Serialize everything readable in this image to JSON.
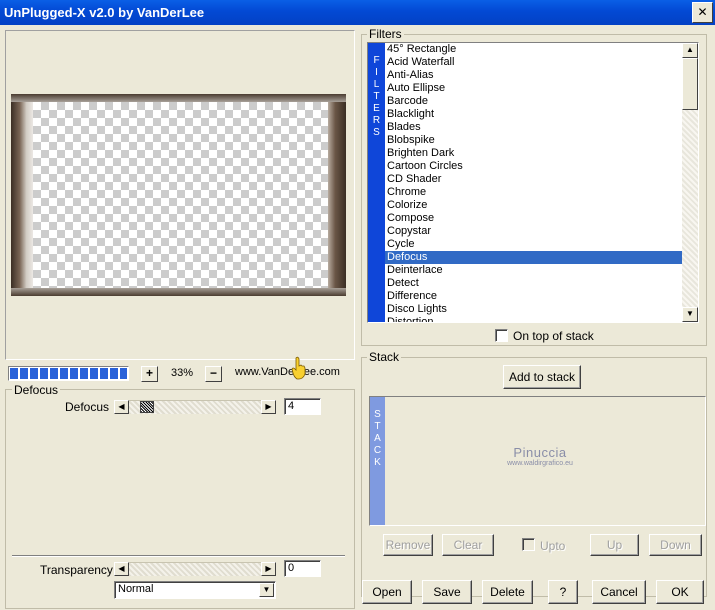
{
  "window": {
    "title": "UnPlugged-X v2.0 by VanDerLee",
    "close_glyph": "✕"
  },
  "preview": {
    "zoom": "33%",
    "zoom_minus": "−",
    "zoom_plus": "+",
    "link": "www.VanDerLee.com",
    "progress_percent": 100
  },
  "params": {
    "group_label": "Defocus",
    "defocus": {
      "label": "Defocus",
      "value": "4"
    },
    "transparency": {
      "label": "Transparency",
      "value": "0"
    },
    "blend_mode": "Normal"
  },
  "filters": {
    "group_label": "Filters",
    "band_letters": [
      "F",
      "I",
      "L",
      "T",
      "E",
      "R",
      "S"
    ],
    "items": [
      "45° Rectangle",
      "Acid Waterfall",
      "Anti-Alias",
      "Auto Ellipse",
      "Barcode",
      "Blacklight",
      "Blades",
      "Blobspike",
      "Brighten Dark",
      "Cartoon Circles",
      "CD Shader",
      "Chrome",
      "Colorize",
      "Compose",
      "Copystar",
      "Cycle",
      "Defocus",
      "Deinterlace",
      "Detect",
      "Difference",
      "Disco Lights",
      "Distortion"
    ],
    "selected": "Defocus",
    "on_top_label": "On top of stack"
  },
  "stack": {
    "group_label": "Stack",
    "add_label": "Add to stack",
    "band_letters": [
      "S",
      "T",
      "A",
      "C",
      "K"
    ],
    "watermark_name": "Pinuccia",
    "watermark_url": "www.waldirgrafico.eu",
    "remove_label": "Remove",
    "clear_label": "Clear",
    "upto_label": "Upto",
    "up_label": "Up",
    "down_label": "Down"
  },
  "footer": {
    "open": "Open",
    "save": "Save",
    "delete": "Delete",
    "help": "?",
    "cancel": "Cancel",
    "ok": "OK"
  }
}
